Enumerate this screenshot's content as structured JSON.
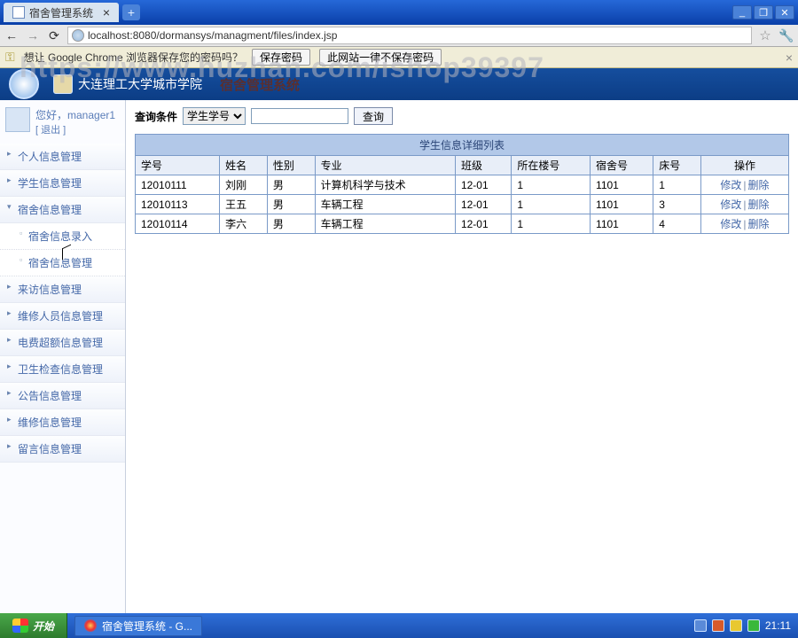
{
  "window": {
    "tab_title": "宿舍管理系统",
    "min": "_",
    "max": "❐",
    "close": "✕",
    "newtab": "+"
  },
  "url": "localhost:8080/dormansys/managment/files/index.jsp",
  "pwbar": {
    "text": "想让 Google Chrome 浏览器保存您的密码吗？",
    "save": "保存密码",
    "never": "此网站一律不保存密码"
  },
  "watermark": "https://www.huzhan.com/ishop39397",
  "header": {
    "uni": "大连理工大学城市学院",
    "sys": "宿舍管理系统"
  },
  "user": {
    "greet": "您好，",
    "name": "manager1",
    "logout": "[ 退出 ]"
  },
  "menu": {
    "items": [
      {
        "label": "个人信息管理"
      },
      {
        "label": "学生信息管理"
      },
      {
        "label": "宿舍信息管理",
        "open": true,
        "children": [
          {
            "label": "宿舍信息录入"
          },
          {
            "label": "宿舍信息管理"
          }
        ]
      },
      {
        "label": "来访信息管理"
      },
      {
        "label": "维修人员信息管理"
      },
      {
        "label": "电费超额信息管理"
      },
      {
        "label": "卫生检查信息管理"
      },
      {
        "label": "公告信息管理"
      },
      {
        "label": "维修信息管理"
      },
      {
        "label": "留言信息管理"
      }
    ]
  },
  "search": {
    "label": "查询条件",
    "field": "学生学号",
    "value": "",
    "btn": "查询"
  },
  "table": {
    "title": "学生信息详细列表",
    "cols": [
      "学号",
      "姓名",
      "性别",
      "专业",
      "班级",
      "所在楼号",
      "宿舍号",
      "床号",
      "操作"
    ],
    "ops": {
      "edit": "修改",
      "del": "删除"
    },
    "rows": [
      [
        "12010111",
        "刘刚",
        "男",
        "计算机科学与技术",
        "12-01",
        "1",
        "1101",
        "1"
      ],
      [
        "12010113",
        "王五",
        "男",
        "车辆工程",
        "12-01",
        "1",
        "1101",
        "3"
      ],
      [
        "12010114",
        "李六",
        "男",
        "车辆工程",
        "12-01",
        "1",
        "1101",
        "4"
      ]
    ]
  },
  "taskbar": {
    "start": "开始",
    "task": "宿舍管理系统 - G...",
    "time": "21:11"
  }
}
